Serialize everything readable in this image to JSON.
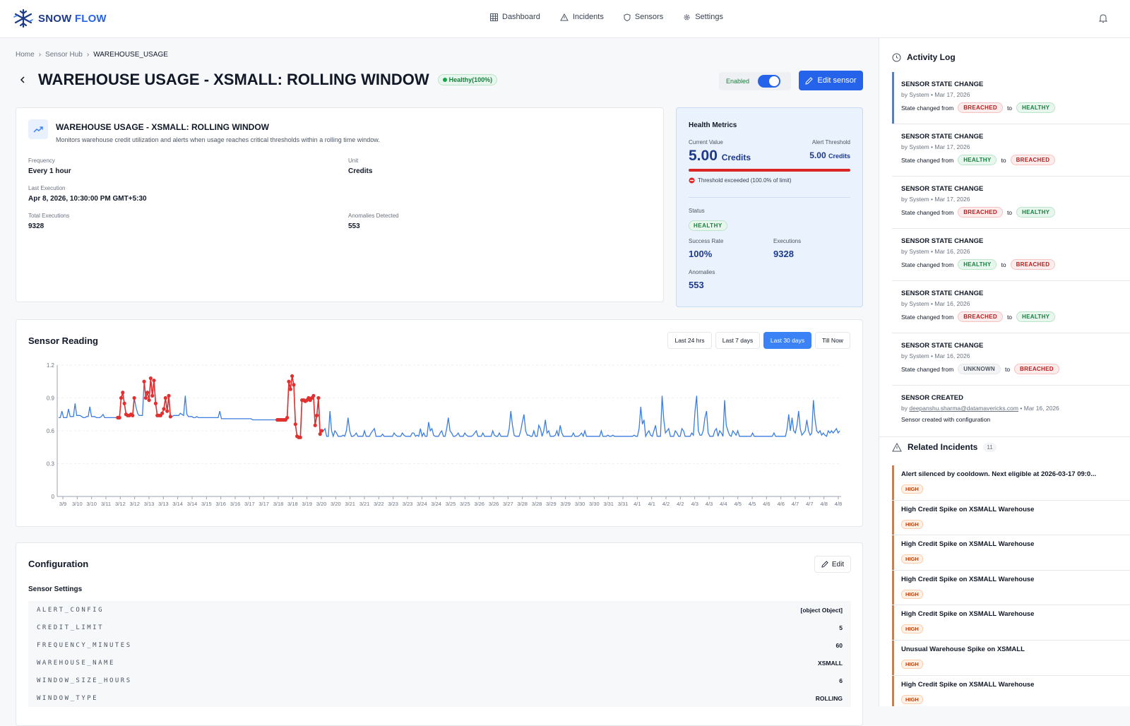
{
  "app": {
    "brand_part1": "SNOW",
    "brand_part2": "FLOW"
  },
  "nav": [
    {
      "label": "Dashboard",
      "icon": "grid-icon"
    },
    {
      "label": "Incidents",
      "icon": "warning-icon"
    },
    {
      "label": "Sensors",
      "icon": "shield-icon"
    },
    {
      "label": "Settings",
      "icon": "gear-icon"
    }
  ],
  "breadcrumb": [
    "Home",
    "Sensor Hub",
    "WAREHOUSE_USAGE"
  ],
  "header": {
    "title": "WAREHOUSE USAGE - XSMALL: ROLLING WINDOW",
    "health_badge": "Healthy(100%)",
    "enabled_label": "Enabled",
    "enabled": true,
    "edit_label": "Edit sensor"
  },
  "info": {
    "title": "WAREHOUSE USAGE - XSMALL: ROLLING WINDOW",
    "description": "Monitors warehouse credit utilization and alerts when usage reaches critical thresholds within a rolling time window.",
    "frequency_label": "Frequency",
    "frequency": "Every 1 hour",
    "unit_label": "Unit",
    "unit": "Credits",
    "last_exec_label": "Last Execution",
    "last_exec": "Apr 8, 2026, 10:30:00 PM GMT+5:30",
    "total_exec_label": "Total Executions",
    "total_exec": "9328",
    "anomalies_label": "Anomalies Detected",
    "anomalies": "553"
  },
  "health": {
    "title": "Health Metrics",
    "current_label": "Current Value",
    "current_value": "5.00",
    "current_unit": "Credits",
    "threshold_label": "Alert Threshold",
    "threshold_value": "5.00",
    "threshold_unit": "Credits",
    "usage_fraction": 1.0,
    "exceeded_text": "Threshold exceeded (100.0% of limit)",
    "status_label": "Status",
    "status": "HEALTHY",
    "success_label": "Success Rate",
    "success": "100%",
    "exec_label": "Executions",
    "exec": "9328",
    "anom_label": "Anomalies",
    "anom": "553"
  },
  "sensor_reading": {
    "title": "Sensor Reading",
    "ranges": [
      "Last 24 hrs",
      "Last 7 days",
      "Last 30 days",
      "Till Now"
    ],
    "active_range": "Last 30 days"
  },
  "chart_data": {
    "type": "line",
    "ylim": [
      0,
      1.2
    ],
    "yticks": [
      "0",
      "0.3",
      "0.6",
      "0.9",
      "1.2"
    ],
    "x_ticks": [
      "3/9",
      "3/10",
      "3/10",
      "3/11",
      "3/12",
      "3/12",
      "3/13",
      "3/13",
      "3/14",
      "3/14",
      "3/15",
      "3/16",
      "3/16",
      "3/17",
      "3/17",
      "3/18",
      "3/18",
      "3/19",
      "3/20",
      "3/20",
      "3/21",
      "3/21",
      "3/22",
      "3/23",
      "3/23",
      "3/24",
      "3/24",
      "3/25",
      "3/25",
      "3/26",
      "3/26",
      "3/27",
      "3/28",
      "3/28",
      "3/29",
      "3/29",
      "3/30",
      "3/30",
      "3/31",
      "3/31",
      "4/1",
      "4/1",
      "4/2",
      "4/2",
      "4/3",
      "4/3",
      "4/4",
      "4/5",
      "4/5",
      "4/6",
      "4/6",
      "4/7",
      "4/7",
      "4/8",
      "4/8"
    ],
    "colors": {
      "line": "#3b7de0",
      "anomaly": "#e03131"
    },
    "series": [
      {
        "values": [
          0.72,
          0.72,
          0.78,
          0.72,
          0.72,
          0.72,
          0.8,
          0.73,
          0.73,
          0.73,
          0.85,
          0.74,
          0.74,
          0.74,
          0.73,
          0.72,
          0.72,
          0.73,
          0.73,
          0.82,
          0.73,
          0.73,
          0.73,
          0.72,
          0.72,
          0.72,
          0.73,
          0.75,
          0.72,
          0.72,
          0.72,
          0.72,
          0.72,
          0.72,
          0.72,
          0.72,
          0.72,
          0.72,
          0.9,
          0.95,
          0.85,
          0.75,
          0.74,
          0.74,
          0.75,
          0.74,
          0.9,
          0.82,
          0.76,
          0.74,
          0.74,
          0.74,
          1.05,
          0.9,
          0.95,
          0.88,
          1.08,
          0.92,
          1.06,
          0.85,
          0.74,
          0.74,
          0.74,
          0.76,
          0.8,
          0.9,
          0.78,
          0.92,
          0.73,
          0.73,
          0.74,
          0.74,
          0.74,
          0.74,
          0.76,
          0.75,
          0.74,
          0.92,
          0.75,
          0.73,
          0.73,
          0.73,
          0.72,
          0.72,
          0.73,
          0.72,
          0.72,
          0.72,
          0.72,
          0.72,
          0.72,
          0.72,
          0.72,
          0.72,
          0.72,
          0.72,
          0.72,
          0.72,
          0.78,
          0.71,
          0.71,
          0.71,
          0.71,
          0.71,
          0.71,
          0.71,
          0.71,
          0.71,
          0.71,
          0.71,
          0.71,
          0.71,
          0.71,
          0.71,
          0.71,
          0.71,
          0.71,
          0.71,
          0.7,
          0.7,
          0.7,
          0.7,
          0.7,
          0.7,
          0.7,
          0.7,
          0.7,
          0.7,
          0.7,
          0.7,
          0.7,
          0.7,
          0.7,
          0.7,
          0.7,
          0.7,
          0.7,
          0.7,
          0.7,
          0.72,
          1.05,
          0.98,
          1.1,
          1.02,
          0.66,
          0.55,
          0.54,
          0.54,
          0.88,
          0.88,
          0.87,
          0.88,
          0.9,
          0.88,
          0.9,
          0.92,
          0.65,
          0.74,
          0.9,
          0.57,
          0.6,
          0.6,
          0.62,
          0.55,
          0.55,
          0.78,
          0.6,
          0.55,
          0.6,
          0.58,
          0.55,
          0.55,
          0.55,
          0.56,
          0.55,
          0.6,
          0.72,
          0.6,
          0.55,
          0.55,
          0.56,
          0.58,
          0.55,
          0.55,
          0.55,
          0.55,
          0.6,
          0.55,
          0.55,
          0.55,
          0.58,
          0.6,
          0.62,
          0.55,
          0.55,
          0.55,
          0.55,
          0.57,
          0.55,
          0.55,
          0.55,
          0.55,
          0.55,
          0.55,
          0.58,
          0.56,
          0.55,
          0.55,
          0.55,
          0.58,
          0.56,
          0.55,
          0.55,
          0.55,
          0.55,
          0.58,
          0.58,
          0.55,
          0.56,
          0.55,
          0.62,
          0.55,
          0.58,
          0.55,
          0.55,
          0.68,
          0.6,
          0.62,
          0.56,
          0.55,
          0.55,
          0.55,
          0.58,
          0.6,
          0.55,
          0.55,
          0.62,
          0.72,
          0.6,
          0.58,
          0.55,
          0.55,
          0.56,
          0.58,
          0.55,
          0.55,
          0.55,
          0.58,
          0.56,
          0.55,
          0.55,
          0.55,
          0.56,
          0.58,
          0.6,
          0.55,
          0.55,
          0.55,
          0.58,
          0.55,
          0.55,
          0.55,
          0.55,
          0.55,
          0.6,
          0.56,
          0.55,
          0.55,
          0.58,
          0.55,
          0.55,
          0.55,
          0.55,
          0.55,
          0.62,
          0.78,
          0.65,
          0.56,
          0.55,
          0.55,
          0.55,
          0.6,
          0.68,
          0.75,
          0.6,
          0.56,
          0.56,
          0.55,
          0.55,
          0.6,
          0.55,
          0.55,
          0.65,
          0.62,
          0.55,
          0.6,
          0.7,
          0.58,
          0.6,
          0.55,
          0.55,
          0.55,
          0.56,
          0.6,
          0.55,
          0.65,
          0.58,
          0.55,
          0.55,
          0.55,
          0.55,
          0.55,
          0.55,
          0.58,
          0.55,
          0.55,
          0.55,
          0.56,
          0.58,
          0.55,
          0.6,
          0.55,
          0.55,
          0.55,
          0.55,
          0.55,
          0.55,
          0.55,
          0.55,
          0.55,
          0.6,
          0.55,
          0.55,
          0.55,
          0.56,
          0.55,
          0.55,
          0.56,
          0.55,
          0.55,
          0.55,
          0.55,
          0.55,
          0.55,
          0.55,
          0.55,
          0.55,
          0.55,
          0.55,
          0.55,
          0.56,
          0.55,
          0.55,
          0.62,
          0.82,
          0.66,
          0.7,
          0.55,
          0.58,
          0.6,
          0.56,
          0.55,
          0.6,
          0.65,
          0.55,
          0.55,
          0.55,
          0.92,
          0.7,
          0.58,
          0.6,
          0.62,
          0.55,
          0.55,
          0.55,
          0.6,
          0.58,
          0.55,
          0.55,
          0.62,
          0.6,
          0.55,
          0.55,
          0.55,
          0.55,
          0.58,
          0.56,
          0.78,
          0.92,
          0.6,
          0.56,
          0.56,
          0.6,
          0.72,
          0.78,
          0.58,
          0.55,
          0.55,
          0.55,
          0.6,
          0.62,
          0.55,
          0.6,
          0.58,
          0.55,
          0.88,
          0.65,
          0.6,
          0.56,
          0.55,
          0.6,
          0.58,
          0.56,
          0.6,
          0.55,
          0.55,
          0.55,
          0.55,
          0.55,
          0.55,
          0.55,
          0.55,
          0.58,
          0.55,
          0.55,
          0.55,
          0.55,
          0.55,
          0.55,
          0.55,
          0.55,
          0.55,
          0.55,
          0.55,
          0.55,
          0.58,
          0.55,
          0.55,
          0.55,
          0.55,
          0.55,
          0.55,
          0.55,
          0.62,
          0.75,
          0.6,
          0.72,
          0.6,
          0.58,
          0.65,
          0.78,
          0.62,
          0.56,
          0.58,
          0.6,
          0.7,
          0.6,
          0.56,
          0.58,
          0.88,
          0.7,
          0.6,
          0.58,
          0.6,
          0.56,
          0.58,
          0.56,
          0.55,
          0.6,
          0.58,
          0.6,
          0.58,
          0.6,
          0.62,
          0.58,
          0.6
        ]
      }
    ],
    "anomalies_index_ranges": [
      [
        36,
        46
      ],
      [
        52,
        68
      ],
      [
        133,
        160
      ]
    ]
  },
  "config": {
    "title": "Configuration",
    "edit_label": "Edit",
    "subtitle": "Sensor Settings",
    "rows": [
      {
        "key": "ALERT_CONFIG",
        "value": "[object Object]"
      },
      {
        "key": "CREDIT_LIMIT",
        "value": "5"
      },
      {
        "key": "FREQUENCY_MINUTES",
        "value": "60"
      },
      {
        "key": "WAREHOUSE_NAME",
        "value": "XSMALL"
      },
      {
        "key": "WINDOW_SIZE_HOURS",
        "value": "6"
      },
      {
        "key": "WINDOW_TYPE",
        "value": "ROLLING"
      }
    ]
  },
  "activity": {
    "title": "Activity Log",
    "items": [
      {
        "title": "SENSOR STATE CHANGE",
        "by": "by System • Mar 17, 2026",
        "prefix": "State changed from",
        "from": "BREACHED",
        "to_word": "to",
        "to": "HEALTHY"
      },
      {
        "title": "SENSOR STATE CHANGE",
        "by": "by System • Mar 17, 2026",
        "prefix": "State changed from",
        "from": "HEALTHY",
        "to_word": "to",
        "to": "BREACHED"
      },
      {
        "title": "SENSOR STATE CHANGE",
        "by": "by System • Mar 17, 2026",
        "prefix": "State changed from",
        "from": "BREACHED",
        "to_word": "to",
        "to": "HEALTHY"
      },
      {
        "title": "SENSOR STATE CHANGE",
        "by": "by System • Mar 16, 2026",
        "prefix": "State changed from",
        "from": "HEALTHY",
        "to_word": "to",
        "to": "BREACHED"
      },
      {
        "title": "SENSOR STATE CHANGE",
        "by": "by System • Mar 16, 2026",
        "prefix": "State changed from",
        "from": "BREACHED",
        "to_word": "to",
        "to": "HEALTHY"
      },
      {
        "title": "SENSOR STATE CHANGE",
        "by": "by System • Mar 16, 2026",
        "prefix": "State changed from",
        "from": "UNKNOWN",
        "to_word": "to",
        "to": "BREACHED"
      }
    ],
    "created": {
      "title": "SENSOR CREATED",
      "by_prefix": "by",
      "user": "deepanshu.sharma@datamavericks.com",
      "date": "• Mar 16, 2026",
      "text": "Sensor created with configuration"
    }
  },
  "incidents": {
    "title": "Related Incidents",
    "count": "11",
    "items": [
      {
        "title": "Alert silenced by cooldown. Next eligible at 2026-03-17 09:0...",
        "severity": "HIGH"
      },
      {
        "title": "High Credit Spike on XSMALL Warehouse",
        "severity": "HIGH"
      },
      {
        "title": "High Credit Spike on XSMALL Warehouse",
        "severity": "HIGH"
      },
      {
        "title": "High Credit Spike on XSMALL Warehouse",
        "severity": "HIGH"
      },
      {
        "title": "High Credit Spike on XSMALL Warehouse",
        "severity": "HIGH"
      },
      {
        "title": "Unusual Warehouse Spike on XSMALL",
        "severity": "HIGH"
      },
      {
        "title": "High Credit Spike on XSMALL Warehouse",
        "severity": "HIGH"
      }
    ]
  }
}
